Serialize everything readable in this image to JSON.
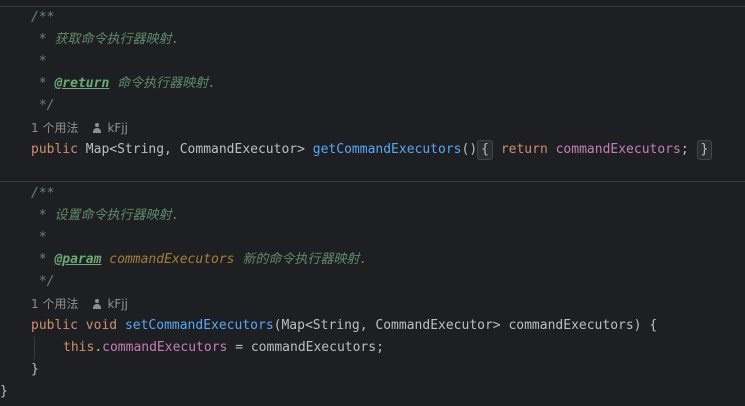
{
  "block1": {
    "doc_open": "/**",
    "doc_line1": " * 获取命令执行器映射.",
    "doc_star": " *",
    "doc_return_prefix": " * ",
    "doc_return_tag": "@return",
    "doc_return_text": " 命令执行器映射.",
    "doc_close": " */",
    "usage": "1 个用法",
    "author": "kFjj",
    "sig_public": "public",
    "sig_type": " Map<String, CommandExecutor> ",
    "sig_method": "getCommandExecutors",
    "sig_parens": "()",
    "sig_open": "{",
    "sig_return": "return",
    "sig_field": "commandExecutors",
    "sig_semicolon": ";",
    "sig_close": "}"
  },
  "block2": {
    "doc_open": "/**",
    "doc_line1": " * 设置命令执行器映射.",
    "doc_star": " *",
    "doc_param_prefix": " * ",
    "doc_param_tag": "@param",
    "doc_param_name": "commandExecutors",
    "doc_param_text": " 新的命令执行器映射.",
    "doc_close": " */",
    "usage": "1 个用法",
    "author": "kFjj",
    "sig_public": "public",
    "sig_void": "void",
    "sig_method": "setCommandExecutors",
    "sig_params": "(Map<String, CommandExecutor> commandExecutors) {",
    "body_this": "this",
    "body_dot": ".",
    "body_field": "commandExecutors",
    "body_assign": " = commandExecutors;",
    "method_close": "}"
  },
  "class_close": "}"
}
